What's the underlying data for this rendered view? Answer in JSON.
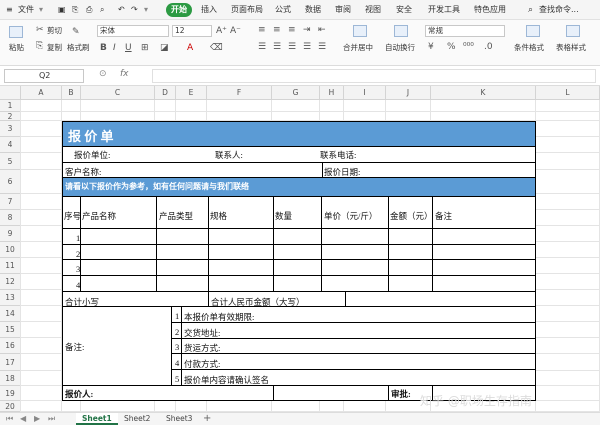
{
  "menu": {
    "file": "文件",
    "tabs": [
      "开始",
      "插入",
      "页面布局",
      "公式",
      "数据",
      "审阅",
      "视图",
      "安全",
      "开发工具",
      "特色应用"
    ],
    "search": "查找命令..."
  },
  "ribbon": {
    "cut": "剪切",
    "paste_label": "粘贴",
    "copy": "复制",
    "format_painter": "格式刷",
    "font_name": "宋体",
    "font_size": "12",
    "merge": "合并居中",
    "wrap": "自动换行",
    "number_format": "常规",
    "conditional": "条件格式",
    "table_style": "表格样式"
  },
  "formula_bar": {
    "name_box": "Q2",
    "fx": "fx"
  },
  "columns": [
    "A",
    "B",
    "C",
    "D",
    "E",
    "F",
    "G",
    "H",
    "I",
    "J",
    "K",
    "L"
  ],
  "rows": [
    "1",
    "2",
    "3",
    "4",
    "5",
    "6",
    "7",
    "8",
    "9",
    "10",
    "11",
    "12",
    "13",
    "14",
    "15",
    "16",
    "17",
    "18",
    "19",
    "20"
  ],
  "form": {
    "title": "报    价    单",
    "quote_unit": "报价单位:",
    "contact": "联系人:",
    "phone": "联系电话:",
    "customer": "客户名称:",
    "quote_date": "报价日期:",
    "notice": "请看以下报价作为参考，如有任何问题请与我们联络",
    "headers": [
      "序号",
      "产品名称",
      "产品类型",
      "规格",
      "数量",
      "单价（元/斤）",
      "金额（元）",
      "备注"
    ],
    "item_numbers": [
      "1",
      "2",
      "3",
      "4"
    ],
    "total_words": "合计小写",
    "total_rmb": "合计人民币金额（大写）",
    "remarks_label": "备注:",
    "remarks": [
      {
        "n": "1",
        "text": "本报价单有效期限:"
      },
      {
        "n": "2",
        "text": "交货地址:"
      },
      {
        "n": "3",
        "text": "货运方式:"
      },
      {
        "n": "4",
        "text": "付款方式:"
      },
      {
        "n": "5",
        "text": "报价单内容请确认签名"
      }
    ],
    "quoter": "报价人:",
    "approver": "审批:"
  },
  "sheets": [
    "Sheet1",
    "Sheet2",
    "Sheet3"
  ],
  "watermark": "知乎 @职场生存指南",
  "colors": {
    "title_bg": "#5b9bd5",
    "notice_bg": "#5b9bd5",
    "start_tab": "#2c9a43"
  }
}
